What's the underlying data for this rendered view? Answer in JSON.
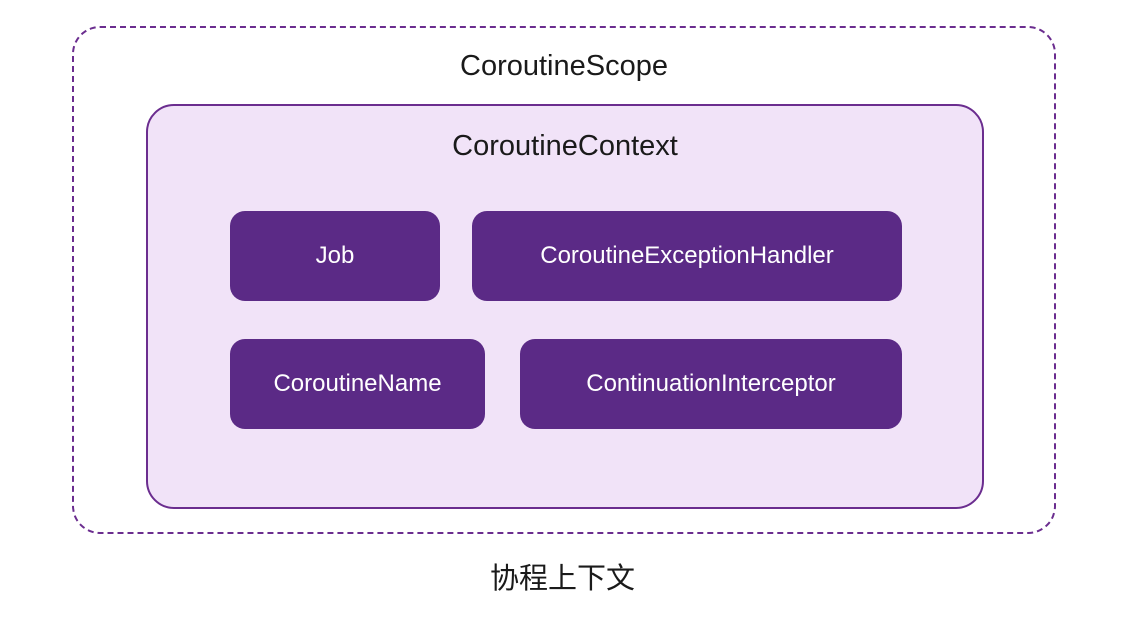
{
  "diagram": {
    "scope_title": "CoroutineScope",
    "context_title": "CoroutineContext",
    "elements": {
      "job": "Job",
      "exception_handler": "CoroutineExceptionHandler",
      "coroutine_name": "CoroutineName",
      "continuation_interceptor": "ContinuationInterceptor"
    },
    "caption": "协程上下文"
  },
  "colors": {
    "border_purple": "#6b2d8f",
    "fill_purple": "#5b2a86",
    "light_purple_bg": "#f1e3f8"
  }
}
